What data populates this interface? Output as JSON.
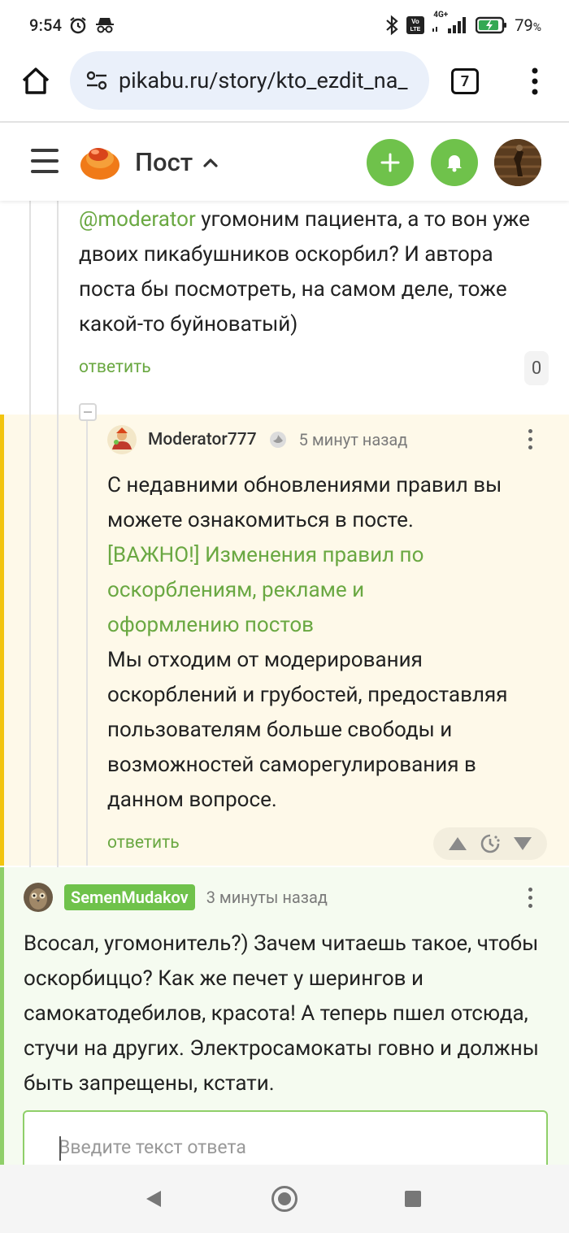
{
  "status": {
    "time": "9:54",
    "network": "4G+",
    "battery": "79",
    "battery_unit": "%",
    "icons": [
      "alarm-icon",
      "incognito-icon",
      "bluetooth-icon",
      "volte-icon",
      "signal-icon",
      "battery-icon"
    ]
  },
  "browser": {
    "url": "pikabu.ru/story/kto_ezdit_na_",
    "tab_count": "7"
  },
  "header": {
    "title": "Пост",
    "accent": "#6fc24b"
  },
  "comment1": {
    "mention": "@moderator",
    "text": " угомоним пациента, а то вон уже двоих пикабушников оскорбил? И автора поста бы посмотреть, на самом деле, тоже какой-то буйноватый)",
    "reply_label": "ответить",
    "score": "0"
  },
  "moderator_comment": {
    "username": "Moderator777",
    "time": "5 минут назад",
    "intro": "С недавними обновлениями правил вы можете ознакомиться в посте.",
    "link_text": "[ВАЖНО!] Изменения правил по оскорблениям, рекламе и оформлению постов",
    "body": "Мы отходим от модерирования оскорблений и грубостей, предоставляя пользователям больше свободы и возможностей саморегулирования в данном вопросе.",
    "reply_label": "ответить"
  },
  "semen_comment": {
    "username": "SemenMudakov",
    "time": "3 минуты назад",
    "text": "Всосал, угомонитель?) Зачем читаешь такое, чтобы оскорбиццо? Как же печет у шерингов и самокатодебилов, красота! А теперь пшел отсюда, стучи на других. Электросамокаты говно и должны быть запрещены, кстати."
  },
  "reply_box": {
    "placeholder": "Введите текст ответа"
  }
}
